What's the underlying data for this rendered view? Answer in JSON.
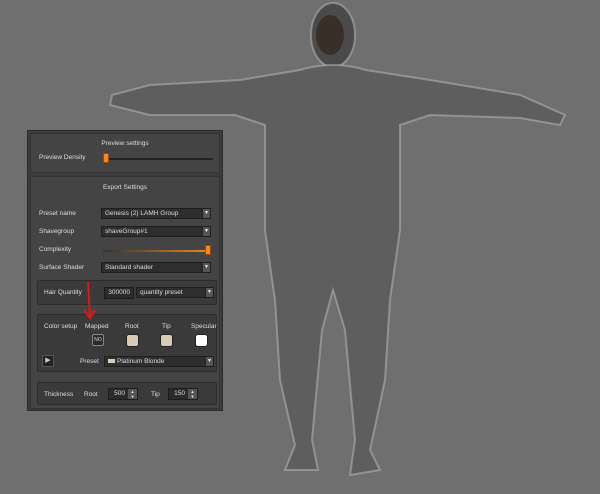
{
  "preview": {
    "title": "Preview settings",
    "density_label": "Preview Density",
    "density_value_fraction": 0.0
  },
  "export": {
    "title": "Export Settings",
    "preset_name_label": "Preset name",
    "preset_name_value": "Genesis (2) LAMH Group",
    "shavegroup_label": "Shavegroup",
    "shavegroup_value": "shaveGroup#1",
    "complexity_label": "Complexity",
    "complexity_value_fraction": 1.0,
    "surface_shader_label": "Surface Shader",
    "surface_shader_value": "Standard shader"
  },
  "hair_quantity": {
    "label": "Hair Quantity",
    "value": "300000",
    "preset": "quantity preset"
  },
  "color_setup": {
    "label": "Color setup",
    "mapped_label": "Mapped",
    "mapped_button": "NO",
    "root_label": "Root",
    "tip_label": "Tip",
    "specular_label": "Specular",
    "root_color": "#d8cbb8",
    "tip_color": "#d8cbb8",
    "specular_color": "#ffffff",
    "preset_label": "Preset",
    "preset_value": "Platinum Blonde"
  },
  "thickness": {
    "label": "Thickness",
    "root_label": "Root",
    "root_value": "500",
    "tip_label": "Tip",
    "tip_value": "150"
  },
  "colors": {
    "accent": "#f08a1c",
    "annotation_arrow": "#d81a1a",
    "background": "#6f6f6f"
  }
}
